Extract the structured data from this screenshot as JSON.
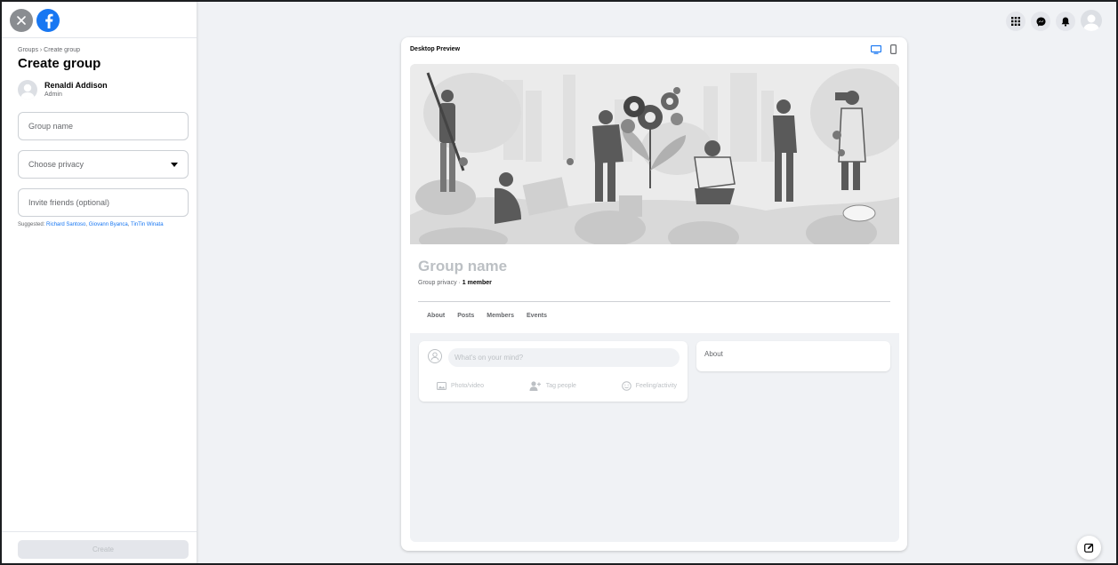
{
  "sidebar": {
    "breadcrumb": "Groups › Create group",
    "title": "Create group",
    "user": {
      "name": "Renaldi Addison",
      "role": "Admin"
    },
    "group_name_placeholder": "Group name",
    "privacy_placeholder": "Choose privacy",
    "invite_placeholder": "Invite friends (optional)",
    "suggested_label": "Suggested: ",
    "suggested_names": [
      "Richard Santoso",
      "Giovann Byanca",
      "TinTin Winata"
    ],
    "create_label": "Create"
  },
  "topbar": {
    "icons": [
      "menu-grid-icon",
      "messenger-icon",
      "notifications-bell-icon",
      "profile-avatar-icon"
    ]
  },
  "preview": {
    "label": "Desktop Preview",
    "device_icons": [
      "desktop-icon",
      "mobile-icon"
    ],
    "group_name": "Group name",
    "privacy_text": "Group privacy · ",
    "member_text": "1 member",
    "tabs": [
      "About",
      "Posts",
      "Members",
      "Events"
    ],
    "composer_placeholder": "What's on your mind?",
    "actions": [
      "Photo/video",
      "Tag people",
      "Feeling/activity"
    ],
    "about_title": "About"
  },
  "colors": {
    "brand": "#1877f2",
    "background": "#f0f2f5"
  }
}
